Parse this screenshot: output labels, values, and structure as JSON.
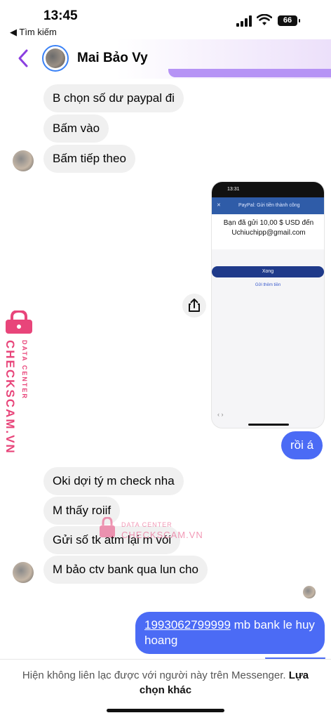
{
  "status_bar": {
    "time": "13:45",
    "back_label": "◀ Tìm kiếm",
    "battery": "66"
  },
  "header": {
    "contact_name": "Mai Bảo Vy"
  },
  "messages": {
    "m1": "B chọn số dư paypal đi",
    "m2": "Bấm vào",
    "m3": "Bấm tiếp theo",
    "m4": "rồi á",
    "m5": "Oki dợi tý m check nha",
    "m6": "M thấy roiif",
    "m7": "Gửi số tk atm lại m vói",
    "m8": "M bảo ctv bank qua lun cho",
    "m9_number": "1993062799999",
    "m9_rest": " mb bank le huy hoang"
  },
  "screenshot": {
    "time": "13:31",
    "header": "PayPal: Gửi tiền thành công",
    "close": "✕",
    "message": "Bạn đã gửi 10,00 $ USD đến Uchiuchipp@gmail.com",
    "done_button": "Xong",
    "send_more": "Gửi thêm tiền",
    "nav": "‹   ›"
  },
  "watermark": {
    "brand": "CHECKSCAM.VN",
    "tagline": "DATA CENTER"
  },
  "notice": {
    "text": "Hiện không liên lạc được với người này trên Messenger. ",
    "action": "Lựa chọn khác"
  },
  "colors": {
    "accent": "#4b6bf5",
    "back_arrow": "#8b3fe0",
    "watermark": "#e8457a"
  }
}
